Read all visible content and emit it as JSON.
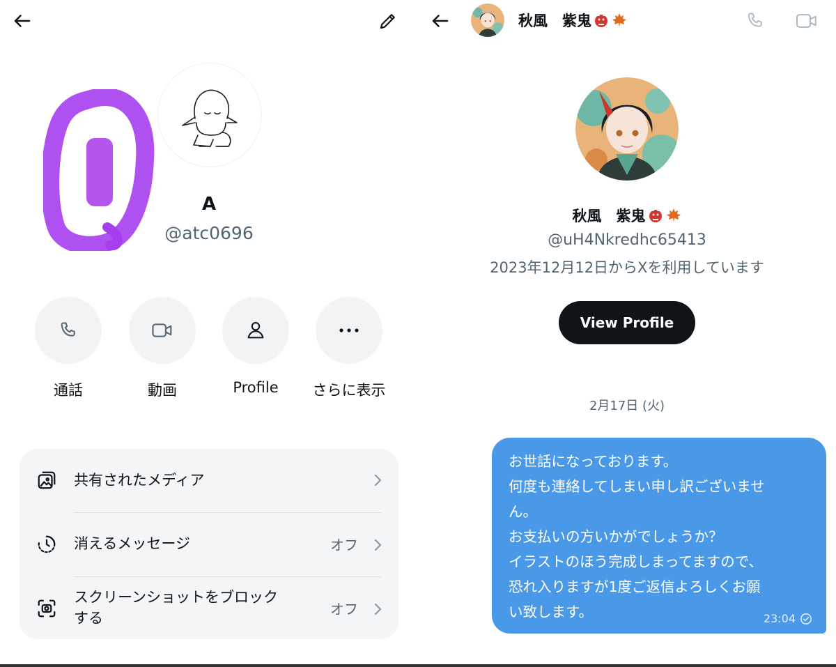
{
  "left_panel": {
    "profile": {
      "name": "A",
      "handle": "@atc0696"
    },
    "actions": [
      {
        "label": "通話",
        "icon": "phone-icon"
      },
      {
        "label": "動画",
        "icon": "video-icon"
      },
      {
        "label": "Profile",
        "icon": "person-icon"
      },
      {
        "label": "さらに表示",
        "icon": "more-icon"
      }
    ],
    "settings": [
      {
        "label": "共有されたメディア",
        "value": "",
        "icon": "media-icon"
      },
      {
        "label": "消えるメッセージ",
        "value": "オフ",
        "icon": "timer-icon"
      },
      {
        "label": "スクリーンショットをブロック\nする",
        "value": "オフ",
        "icon": "screenshot-icon"
      }
    ]
  },
  "right_panel": {
    "header": {
      "name": "秋風　紫鬼"
    },
    "profile": {
      "name": "秋風　紫鬼",
      "handle": "@uH4Nkredhc65413",
      "joined": "2023年12月12日からXを利用しています",
      "view_profile_label": "View Profile"
    },
    "date_separator": "2月17日 (火)",
    "message": {
      "text": "お世話になっております。\n何度も連絡してしまい申し訳ございませ\nん。\nお支払いの方いかがでしょうか？\nイラストのほう完成しまってますので、\n恐れ入りますが1度ご返信よろしくお願\nい致します。",
      "time": "23:04"
    }
  },
  "colors": {
    "bubble": "#4a99e9",
    "button_dark": "#0f1419",
    "muted_text": "#536471",
    "action_circle": "#f2f3f4",
    "redaction_purple": "#a63ef0"
  }
}
